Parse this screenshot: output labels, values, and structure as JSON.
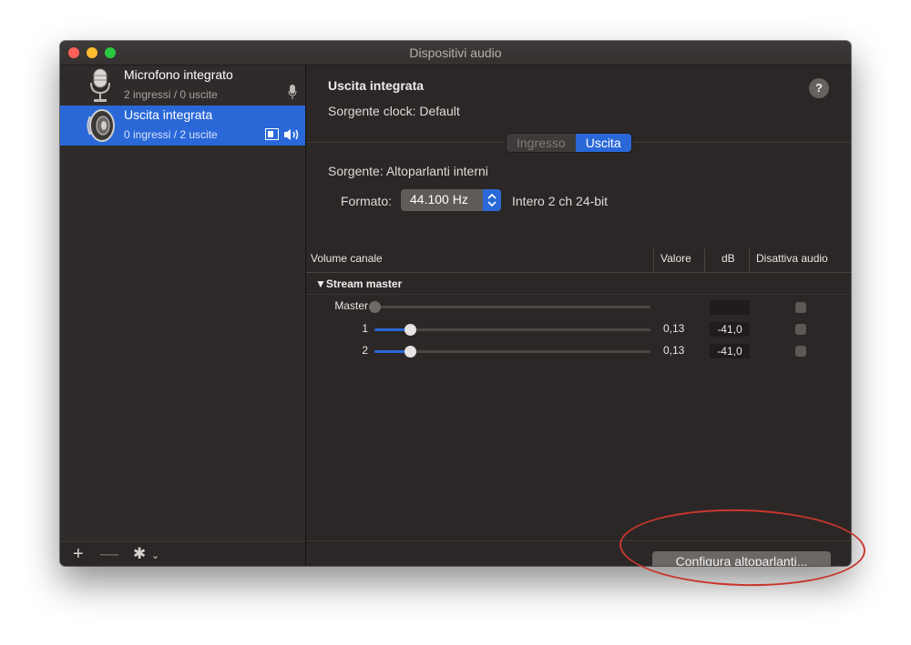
{
  "window": {
    "title": "Dispositivi audio"
  },
  "sidebar": {
    "devices": [
      {
        "name": "Microfono integrato",
        "sub": "2 ingressi / 0 uscite",
        "icon": "microphone-icon"
      },
      {
        "name": "Uscita integrata",
        "sub": "0 ingressi / 2 uscite",
        "icon": "speaker-icon"
      }
    ],
    "bottom": {
      "add": "+",
      "remove": "—",
      "settings": "✱",
      "chevron": "⌄"
    }
  },
  "detail": {
    "title": "Uscita integrata",
    "clock": "Sorgente clock:  Default",
    "help": "?",
    "tabs": [
      "Ingresso",
      "Uscita"
    ],
    "selected_tab": "Uscita",
    "source": "Sorgente:  Altoparlanti interni",
    "format_label": "Formato:",
    "format_value": "44.100 Hz",
    "format_desc": "Intero 2 ch 24-bit",
    "columns": [
      "Volume canale",
      "Valore",
      "dB",
      "Disattiva audio"
    ],
    "group": "▼Stream master",
    "channels": [
      {
        "label": "Master",
        "value": "",
        "db": "",
        "level": 0,
        "muted": false
      },
      {
        "label": "1",
        "value": "0,13",
        "db": "-41,0",
        "level": 0.13,
        "muted": false
      },
      {
        "label": "2",
        "value": "0,13",
        "db": "-41,0",
        "level": 0.13,
        "muted": false
      }
    ],
    "configure_button": "Configura altoparlanti..."
  },
  "colors": {
    "accent": "#2a68d8",
    "annotation": "#c8372e"
  }
}
